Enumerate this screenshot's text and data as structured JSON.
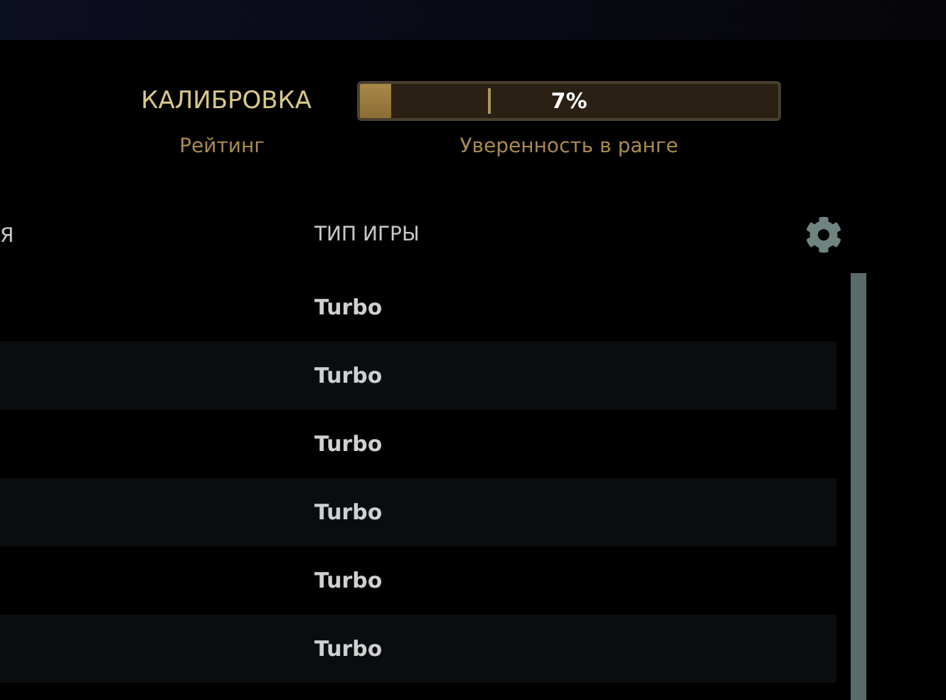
{
  "calibration": {
    "title": "КАЛИБРОВКА",
    "label": "Рейтинг",
    "confidence": {
      "level": 0.075,
      "reading": "7%",
      "label": "Уверенность в ранге"
    }
  },
  "table": {
    "columns": [
      "Я",
      "ТИП ИГРЫ"
    ],
    "rows": [
      {
        "game_type": "Turbo"
      },
      {
        "game_type": "Turbo"
      },
      {
        "game_type": "Turbo"
      },
      {
        "game_type": "Turbo"
      },
      {
        "game_type": "Turbo"
      },
      {
        "game_type": "Turbo"
      }
    ]
  }
}
